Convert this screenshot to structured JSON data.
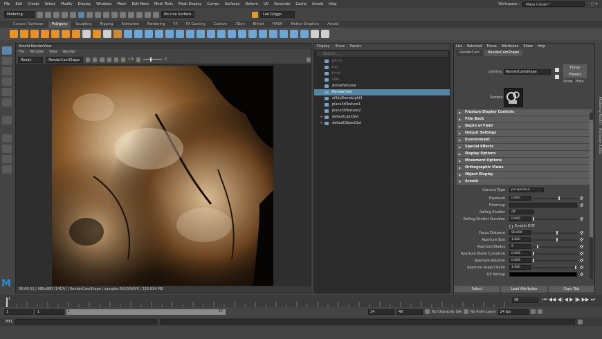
{
  "menubar": {
    "items": [
      "File",
      "Edit",
      "Create",
      "Select",
      "Modify",
      "Display",
      "Windows",
      "Mesh",
      "Edit Mesh",
      "Mesh Tools",
      "Mesh Display",
      "Curves",
      "Surfaces",
      "Deform",
      "UV",
      "Generate",
      "Cache",
      "Arnold",
      "Help"
    ],
    "workspace_label": "Workspace :",
    "workspace_value": "Maya Classic*"
  },
  "statusline": {
    "mode": "Modeling",
    "live_surface": "No Live Surface",
    "user": "Lee Griggs"
  },
  "shelf": {
    "tabs": [
      "Curves / Surfaces",
      "Polygons",
      "Sculpting",
      "Rigging",
      "Animation",
      "Rendering",
      "FX",
      "FX Caching",
      "Custom",
      "XGen",
      "Bifrost",
      "MASH",
      "Motion Graphics",
      "Arnold"
    ],
    "active_tab": "Polygons",
    "icon_colors": [
      "#e8912a",
      "#e8912a",
      "#e8912a",
      "#e8912a",
      "#e8912a",
      "#e8912a",
      "#e8912a",
      "#d0d0d0",
      "#e8912a",
      "#d0d0d0",
      "#c98a3a",
      "#6ea6d6",
      "#6ea6d6",
      "#6ea6d6",
      "#6ea6d6",
      "#6ea6d6",
      "#6ea6d6",
      "#6ea6d6",
      "#6ea6d6",
      "#6ea6d6",
      "#6ea6d6",
      "#6ea6d6",
      "#6ea6d6",
      "#6ea6d6",
      "#6ea6d6",
      "#6ea6d6",
      "#6ea6d6",
      "#6ea6d6",
      "#6ea6d6",
      "#d0d0d0",
      "#d0d0d0"
    ]
  },
  "renderview": {
    "title": "Arnold RenderView",
    "menu": [
      "File",
      "Window",
      "View",
      "Render"
    ],
    "state": "Ready",
    "camera": "RenderCamShape",
    "ratio": "1:1",
    "exposure": "0",
    "status": "00:06:52 | 980x980 (141%) | RenderCamShape | samples 6/0/0/0/0/0 | 329.934 MB"
  },
  "outliner": {
    "menu": [
      "Display",
      "Show",
      "Panels"
    ],
    "search_placeholder": "Search...",
    "items": [
      {
        "label": "persp",
        "state": "dim"
      },
      {
        "label": "top",
        "state": "dim"
      },
      {
        "label": "front",
        "state": "dim"
      },
      {
        "label": "side",
        "state": "dim"
      },
      {
        "label": "ArnoldVolume",
        "state": "normal"
      },
      {
        "label": "RenderCam",
        "state": "selected"
      },
      {
        "label": "aiSkyDomeLight1",
        "state": "normal"
      },
      {
        "label": "place3dTexture1",
        "state": "normal"
      },
      {
        "label": "place3dTexture2",
        "state": "normal"
      },
      {
        "label": "defaultLightSet",
        "state": "normal"
      },
      {
        "label": "defaultObjectSet",
        "state": "normal"
      }
    ]
  },
  "attribute_editor": {
    "menu": [
      "List",
      "Selected",
      "Focus",
      "Attributes",
      "Show",
      "Help"
    ],
    "tabs": [
      "RenderCam",
      "RenderCamShape"
    ],
    "active_tab": "RenderCamShape",
    "node_type": "camera:",
    "node_name": "RenderCamShape",
    "buttons": {
      "focus": "Focus",
      "presets": "Presets",
      "show": "Show",
      "hide": "Hide"
    },
    "sample_label": "Sample",
    "sections": [
      "Frustum Display Controls",
      "Film Back",
      "Depth of Field",
      "Output Settings",
      "Environment",
      "Special Effects",
      "Display Options",
      "Movement Options",
      "Orthographic Views",
      "Object Display",
      "Arnold"
    ],
    "camera_type_label": "Camera Type",
    "camera_type": "perspective",
    "attrs": [
      {
        "label": "Exposure",
        "value": "0.000",
        "slider": 0.6
      },
      {
        "label": "Filtermap",
        "value": ""
      },
      {
        "label": "Rolling Shutter",
        "value": "off",
        "dropdown": true
      },
      {
        "label": "Rolling Shutter Duration",
        "value": "0.000",
        "slider": 0.0
      },
      {
        "label": "Enable DOF",
        "value": "",
        "checkbox": true
      },
      {
        "label": "Focus Distance",
        "value": "90.000",
        "slider": 0.55
      },
      {
        "label": "Aperture Size",
        "value": "1.000",
        "slider": 0.55
      },
      {
        "label": "Aperture Blades",
        "value": "5",
        "slider": 0.1
      },
      {
        "label": "Aperture Blade Curvature",
        "value": "0.000",
        "slider": 0.0
      },
      {
        "label": "Aperture Rotation",
        "value": "0.000",
        "slider": 0.0
      },
      {
        "label": "Aperture Aspect Ratio",
        "value": "1.000",
        "slider": 0.98
      },
      {
        "label": "UV Remap",
        "value": ""
      }
    ],
    "footer": [
      "Select",
      "Load Attributes",
      "Copy Tab"
    ]
  },
  "timeslider": {
    "ticks": [
      "1",
      "",
      "",
      "",
      "",
      "",
      "",
      "",
      "",
      "",
      "",
      "",
      "",
      "",
      "",
      "",
      "",
      "",
      "",
      "",
      "",
      "",
      "",
      "",
      ""
    ],
    "current_frame": "48"
  },
  "rangeslider": {
    "start": "1",
    "inner_start": "1",
    "marker": "1",
    "end_inner": "24",
    "end_a": "24",
    "end_b": "48",
    "char_set": "No Character Set",
    "anim_layer": "No Anim Layer",
    "fps": "24 fps"
  },
  "cmdline": {
    "label": "MEL"
  }
}
